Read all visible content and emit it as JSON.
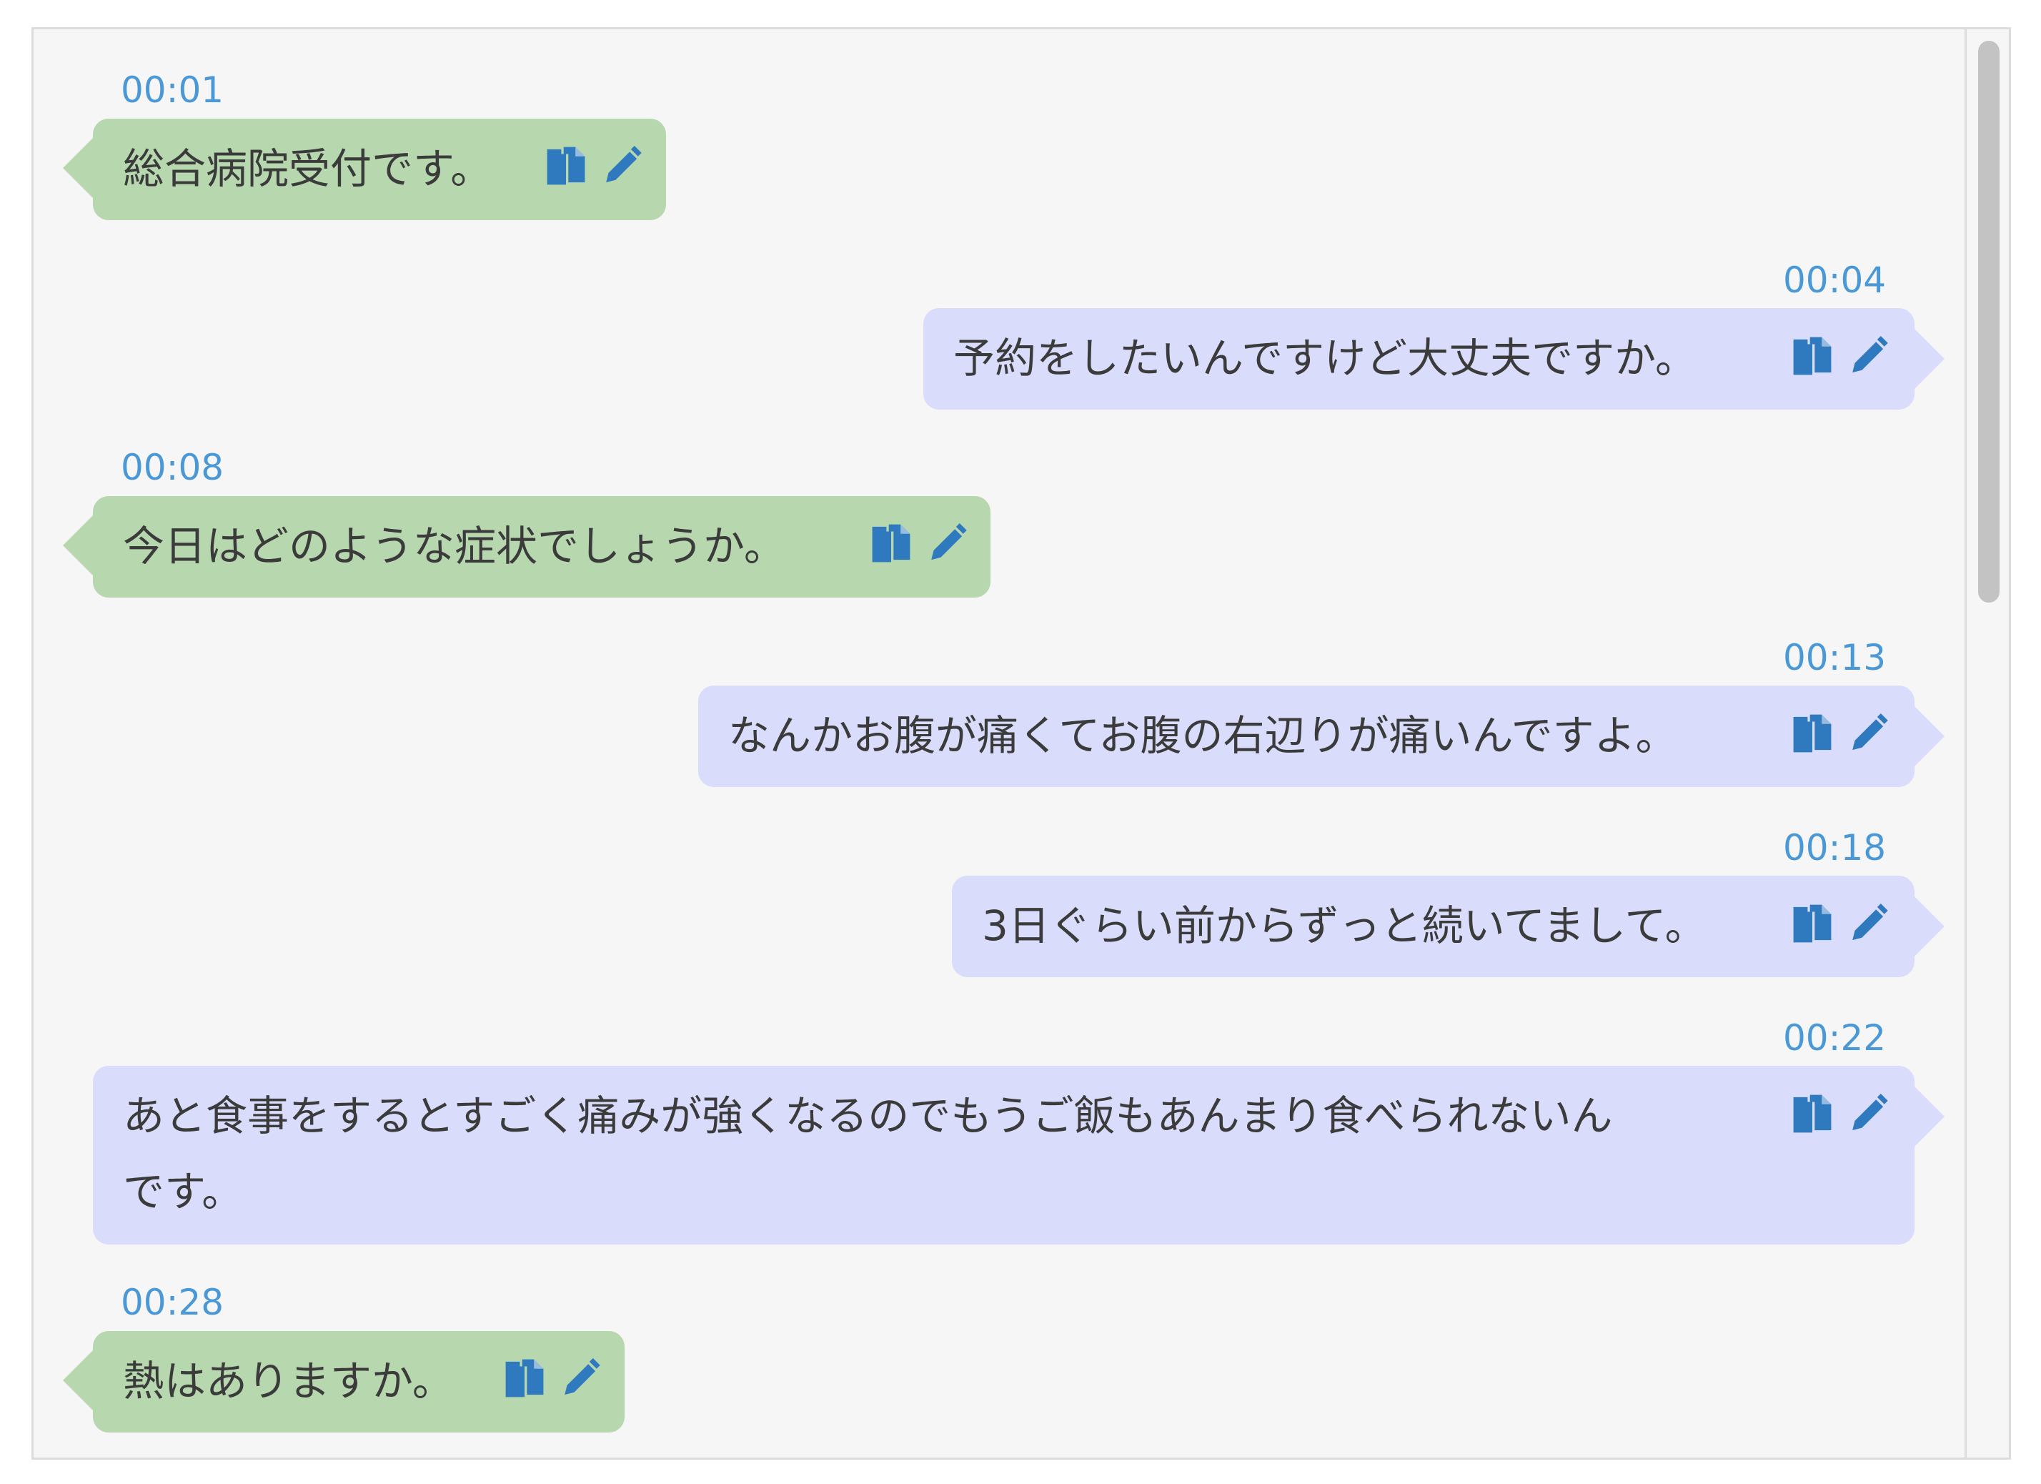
{
  "messages": [
    {
      "time": "00:01",
      "speaker": "agent",
      "text": "総合病院受付です。"
    },
    {
      "time": "00:04",
      "speaker": "caller",
      "text": "予約をしたいんですけど大丈夫ですか。"
    },
    {
      "time": "00:08",
      "speaker": "agent",
      "text": "今日はどのような症状でしょうか。"
    },
    {
      "time": "00:13",
      "speaker": "caller",
      "text": "なんかお腹が痛くてお腹の右辺りが痛いんですよ。"
    },
    {
      "time": "00:18",
      "speaker": "caller",
      "text": "3日ぐらい前からずっと続いてまして。"
    },
    {
      "time": "00:22",
      "speaker": "caller",
      "text_line1": "あと食事をするとすごく痛みが強くなるのでもうご飯もあんまり食べられないん",
      "text_line2": "です。"
    },
    {
      "time": "00:28",
      "speaker": "agent",
      "text": "熱はありますか。"
    }
  ],
  "colors": {
    "agent_bubble": "#b7d8ae",
    "caller_bubble": "#d9dcfa",
    "timestamp": "#4a98d6",
    "icon": "#2f79bf"
  },
  "icons": [
    "copy-icon",
    "edit-icon"
  ]
}
